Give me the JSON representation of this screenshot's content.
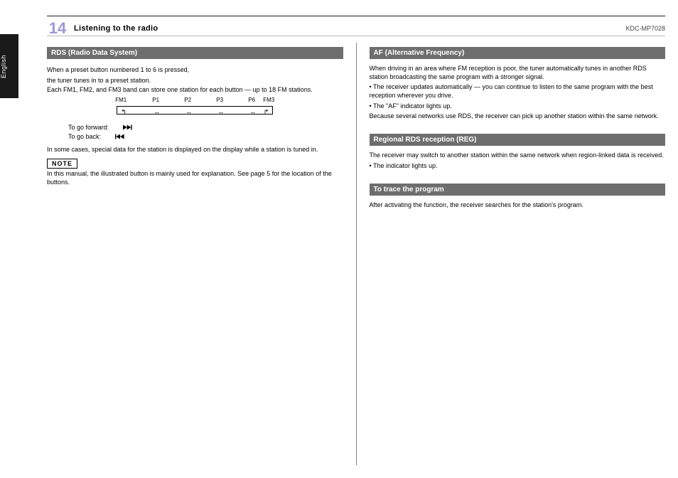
{
  "page": {
    "tab": "English",
    "number": "14",
    "header_title": "Listening to the radio",
    "header_unit": "KDC-MP7028",
    "top_rule": true
  },
  "left": {
    "section_title": "RDS (Radio Data System)",
    "preset_note": "When a preset button numbered 1 to 6 is pressed,",
    "preset_bullet": "the tuner tunes in to a preset station.",
    "body1": "Each FM1, FM2, and FM3 band can store one station for each button — up to 18 FM stations.",
    "diagram": {
      "left_label": "FM1",
      "right_label": "FM3",
      "mid1": "P1",
      "mid2": "P2",
      "mid3": "P3",
      "mid4": "P6"
    },
    "skip_fwd_label": "To go forward:",
    "skip_back_label": "To go back:",
    "body2": "In some cases, special data for the station is displayed on the display while a station is tuned in.",
    "note_label": "NOTE",
    "note_body": "In this manual, the illustrated button is mainly used for explanation. See page 5 for the location of the buttons."
  },
  "right": {
    "section1_title": "AF (Alternative Frequency)",
    "s1_body1": "When driving in an area where FM reception is poor, the tuner automatically tunes in another RDS station broadcasting the same program with a stronger signal.",
    "s1_bullet1": "• The receiver updates automatically — you can continue to listen to the same program with the best reception wherever you drive.",
    "s1_bullet2": "• The \"AF\" indicator lights up.",
    "s1_body2": "Because several networks use RDS, the receiver can pick up another station within the same network.",
    "section2_title": "Regional RDS reception (REG)",
    "s2_body1": "The receiver may switch to another station within the same network when region-linked data is received.",
    "s2_body2": "• The indicator lights up.",
    "section3_title": "To trace the program",
    "s3_body1": "After activating the function, the receiver searches for the station's program."
  }
}
